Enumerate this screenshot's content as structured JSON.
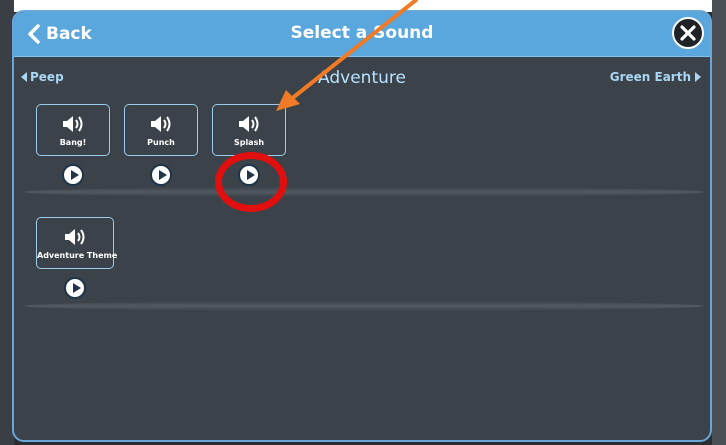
{
  "header": {
    "back_label": "Back",
    "title": "Select a Sound"
  },
  "nav": {
    "prev_label": "Peep",
    "category": "Adventure",
    "next_label": "Green Earth"
  },
  "sounds": [
    {
      "label": "Bang!"
    },
    {
      "label": "Punch"
    },
    {
      "label": "Splash"
    },
    {
      "label": "Adventure Theme"
    }
  ],
  "icons": {
    "back": "chevron-left-icon",
    "close": "close-icon",
    "prev": "caret-left-icon",
    "next": "caret-right-icon",
    "sound": "speaker-icon",
    "play": "play-icon"
  },
  "colors": {
    "titlebar": "#5aa7dd",
    "panel": "#3b4249",
    "annotation_circle": "#e20f0f",
    "annotation_arrow": "#f07a25"
  }
}
